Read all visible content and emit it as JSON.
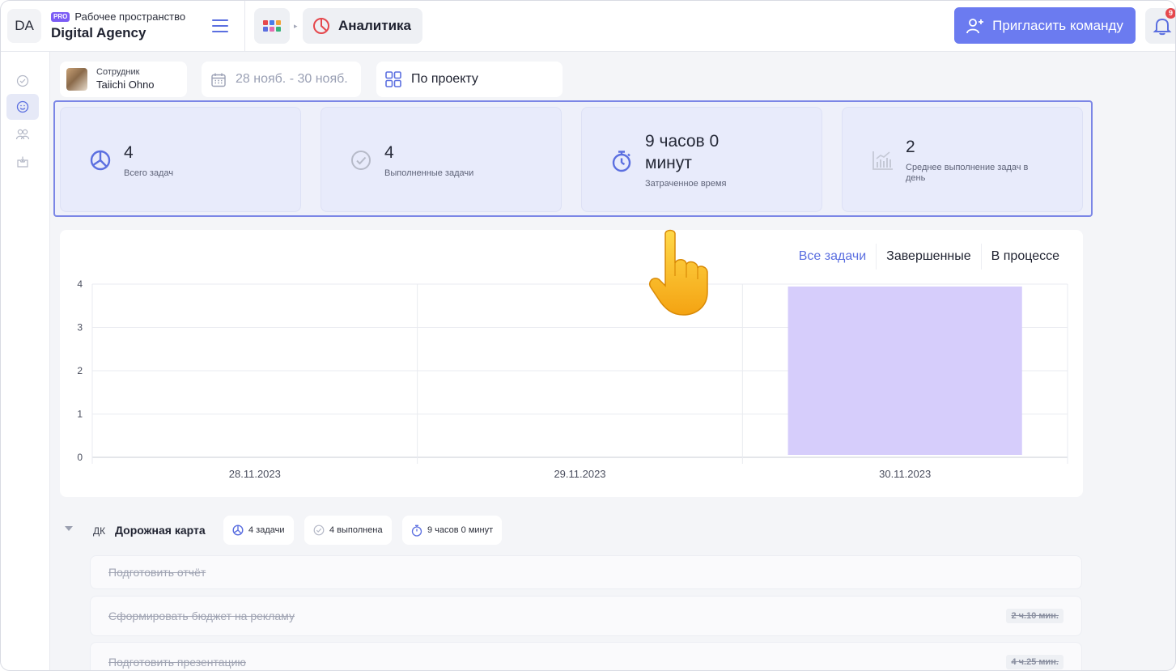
{
  "header": {
    "workspace_initials": "DA",
    "workspace_badge": "PRO",
    "workspace_label": "Рабочее пространство",
    "workspace_name": "Digital Agency",
    "breadcrumb_current": "Аналитика",
    "invite_button": "Пригласить команду",
    "notification_count": "9"
  },
  "sidebar": {
    "items": [
      {
        "icon": "check-circle-icon",
        "active": false
      },
      {
        "icon": "smile-icon",
        "active": true
      },
      {
        "icon": "users-icon",
        "active": false
      },
      {
        "icon": "inbox-icon",
        "active": false
      }
    ]
  },
  "filters": {
    "employee_label": "Сотрудник",
    "employee_name": "Taiichi Ohno",
    "date_range": "28 нояб. - 30 нояб.",
    "group_by": "По проекту"
  },
  "stats": [
    {
      "value": "4",
      "label": "Всего задач",
      "icon": "pie-icon"
    },
    {
      "value": "4",
      "label": "Выполненные задачи",
      "icon": "check-circle-icon"
    },
    {
      "value": "9 часов 0 минут",
      "value_line1": "9 часов 0",
      "value_line2": "минут",
      "label": "Затраченное время",
      "icon": "stopwatch-icon"
    },
    {
      "value": "2",
      "label": "Среднее выполнение задач в день",
      "label_line1": "Среднее выполнение задач в",
      "label_line2": "день",
      "icon": "bar-chart-icon"
    }
  ],
  "chart_tabs": [
    "Все задачи",
    "Завершенные",
    "В процессе"
  ],
  "chart_data": {
    "type": "bar",
    "categories": [
      "28.11.2023",
      "29.11.2023",
      "30.11.2023"
    ],
    "values": [
      0,
      0,
      4
    ],
    "ylim": [
      0,
      4
    ],
    "yticks": [
      0,
      1,
      2,
      3,
      4
    ],
    "grid": true,
    "bar_color": "#d6cdfb"
  },
  "project": {
    "abbr": "ДК",
    "name": "Дорожная карта",
    "tasks_chip": "4 задачи",
    "done_chip": "4 выполнена",
    "time_chip": "9 часов 0 минут"
  },
  "tasks": [
    {
      "title": "Подготовить отчёт",
      "time": ""
    },
    {
      "title": "Сформировать бюджет на рекламу",
      "time": "2 ч.10 мин."
    },
    {
      "title": "Подготовить презентацию",
      "time": "4 ч.25 мин."
    }
  ],
  "colors": {
    "accent": "#6b7bf0",
    "card_bg": "#e8ebfb",
    "frame_border": "#7b86e6"
  }
}
